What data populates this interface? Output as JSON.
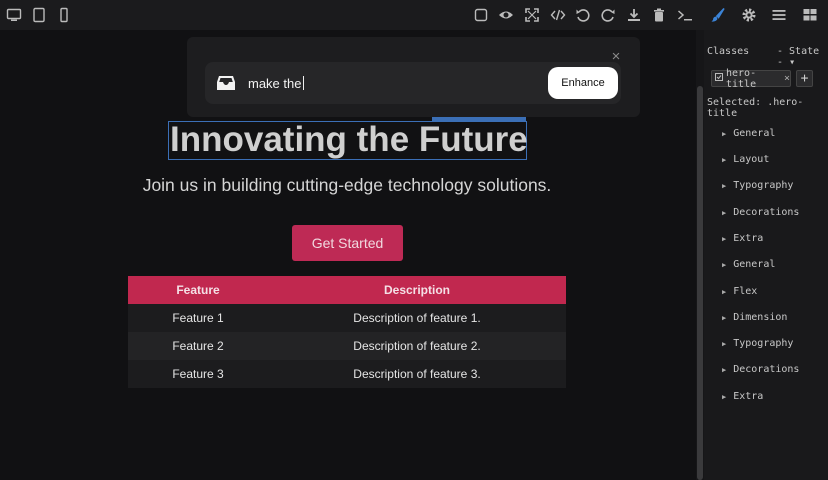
{
  "toolbar": {
    "left_icons": [
      "desktop-icon",
      "tablet-icon",
      "mobile-icon"
    ],
    "right_icons": [
      "square-icon",
      "eye-icon",
      "fullscreen-icon",
      "code-icon",
      "undo-icon",
      "redo-icon",
      "download-icon",
      "trash-icon",
      "terminal-icon"
    ],
    "panel_icons": [
      "paint-brush-icon",
      "gear-icon",
      "menu-icon",
      "blocks-icon"
    ]
  },
  "prompt": {
    "text": "make the",
    "button": "Enhance",
    "close": "×"
  },
  "hero": {
    "title": "Innovating the Future",
    "subtitle": "Join us in building cutting-edge technology solutions.",
    "cta": "Get Started"
  },
  "table": {
    "headers": [
      "Feature",
      "Description"
    ],
    "rows": [
      [
        "Feature 1",
        "Description of feature 1."
      ],
      [
        "Feature 2",
        "Description of feature 2."
      ],
      [
        "Feature 3",
        "Description of feature 3."
      ]
    ]
  },
  "panel": {
    "classes_label": "Classes",
    "state_label": "- State -",
    "tag": "hero-title",
    "tag_remove": "×",
    "add": "+",
    "selected": "Selected: .hero-title",
    "sections": [
      "General",
      "Layout",
      "Typography",
      "Decorations",
      "Extra",
      "General",
      "Flex",
      "Dimension",
      "Typography",
      "Decorations",
      "Extra"
    ]
  },
  "colors": {
    "accent": "#be2a55",
    "selection": "#3b6fb6",
    "brush_active": "#3b83d6"
  }
}
